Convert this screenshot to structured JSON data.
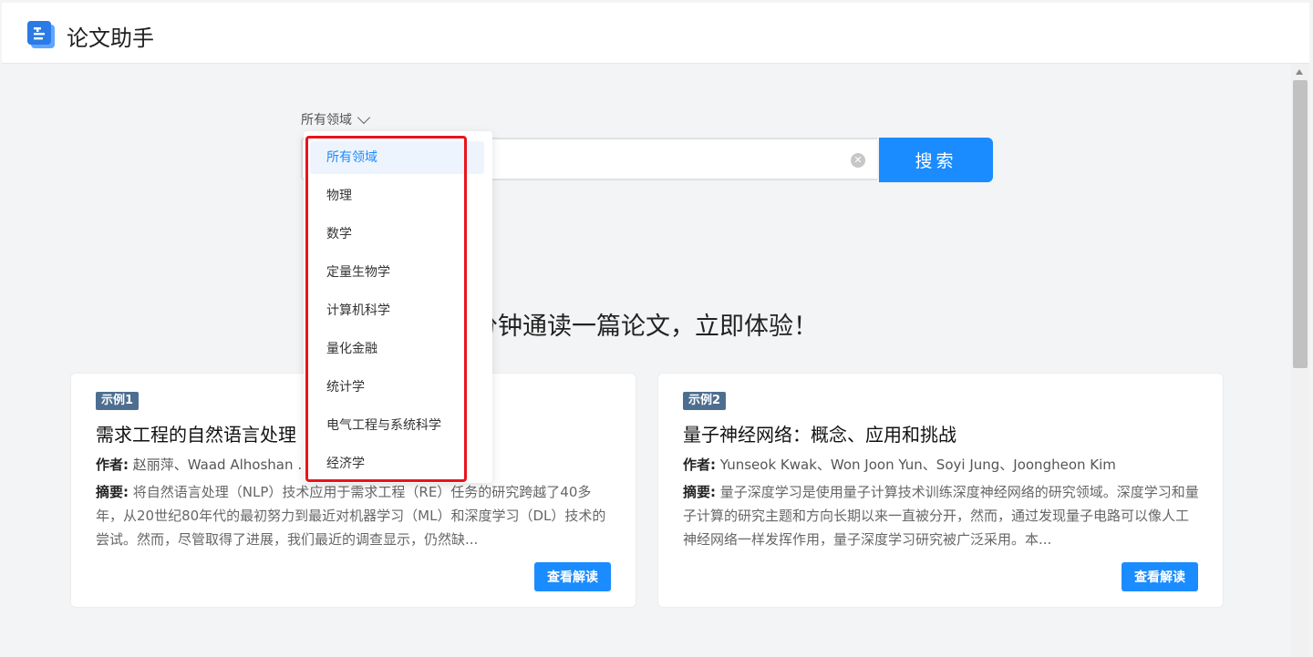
{
  "app": {
    "title": "论文助手"
  },
  "search": {
    "field_selected": "所有领域",
    "button_label": "搜索"
  },
  "dropdown": {
    "options": [
      "所有领域",
      "物理",
      "数学",
      "定量生物学",
      "计算机科学",
      "量化金融",
      "统计学",
      "电气工程与系统科学",
      "经济学"
    ],
    "selected_index": 0
  },
  "headline": "分钟通读一篇论文，立即体验！",
  "cards": [
    {
      "badge": "示例1",
      "title": "需求工程的自然语言处理",
      "authors_label": "作者:",
      "authors": "赵丽萍、Waad Alhoshan … Letsholo",
      "abstract_label": "摘要:",
      "abstract": "将自然语言处理（NLP）技术应用于需求工程（RE）任务的研究跨越了40多年，从20世纪80年代的最初努力到最近对机器学习（ML）和深度学习（DL）技术的尝试。然而，尽管取得了进展，我们最近的调查显示，仍然缺...",
      "button": "查看解读"
    },
    {
      "badge": "示例2",
      "title": "量子神经网络：概念、应用和挑战",
      "authors_label": "作者:",
      "authors": "Yunseok Kwak、Won Joon Yun、Soyi Jung、Joongheon Kim",
      "abstract_label": "摘要:",
      "abstract": "量子深度学习是使用量子计算技术训练深度神经网络的研究领域。深度学习和量子计算的研究主题和方向长期以来一直被分开，然而，通过发现量子电路可以像人工神经网络一样发挥作用，量子深度学习研究被广泛采用。本...",
      "button": "查看解读"
    }
  ],
  "colors": {
    "accent": "#1a8cff",
    "highlight": "#e8141c",
    "badge": "#4e6e90"
  }
}
